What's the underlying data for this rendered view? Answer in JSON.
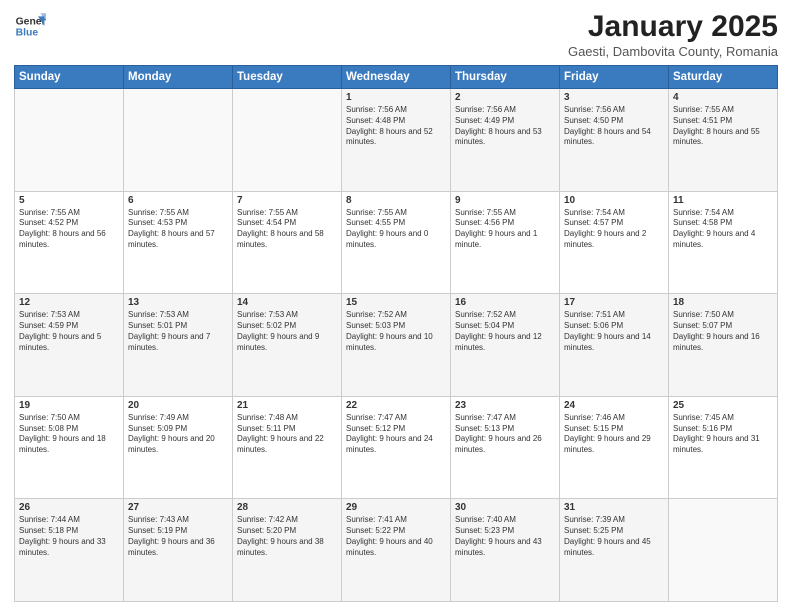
{
  "logo": {
    "line1": "General",
    "line2": "Blue"
  },
  "title": "January 2025",
  "subtitle": "Gaesti, Dambovita County, Romania",
  "weekdays": [
    "Sunday",
    "Monday",
    "Tuesday",
    "Wednesday",
    "Thursday",
    "Friday",
    "Saturday"
  ],
  "weeks": [
    [
      {
        "day": "",
        "info": ""
      },
      {
        "day": "",
        "info": ""
      },
      {
        "day": "",
        "info": ""
      },
      {
        "day": "1",
        "info": "Sunrise: 7:56 AM\nSunset: 4:48 PM\nDaylight: 8 hours and 52 minutes."
      },
      {
        "day": "2",
        "info": "Sunrise: 7:56 AM\nSunset: 4:49 PM\nDaylight: 8 hours and 53 minutes."
      },
      {
        "day": "3",
        "info": "Sunrise: 7:56 AM\nSunset: 4:50 PM\nDaylight: 8 hours and 54 minutes."
      },
      {
        "day": "4",
        "info": "Sunrise: 7:55 AM\nSunset: 4:51 PM\nDaylight: 8 hours and 55 minutes."
      }
    ],
    [
      {
        "day": "5",
        "info": "Sunrise: 7:55 AM\nSunset: 4:52 PM\nDaylight: 8 hours and 56 minutes."
      },
      {
        "day": "6",
        "info": "Sunrise: 7:55 AM\nSunset: 4:53 PM\nDaylight: 8 hours and 57 minutes."
      },
      {
        "day": "7",
        "info": "Sunrise: 7:55 AM\nSunset: 4:54 PM\nDaylight: 8 hours and 58 minutes."
      },
      {
        "day": "8",
        "info": "Sunrise: 7:55 AM\nSunset: 4:55 PM\nDaylight: 9 hours and 0 minutes."
      },
      {
        "day": "9",
        "info": "Sunrise: 7:55 AM\nSunset: 4:56 PM\nDaylight: 9 hours and 1 minute."
      },
      {
        "day": "10",
        "info": "Sunrise: 7:54 AM\nSunset: 4:57 PM\nDaylight: 9 hours and 2 minutes."
      },
      {
        "day": "11",
        "info": "Sunrise: 7:54 AM\nSunset: 4:58 PM\nDaylight: 9 hours and 4 minutes."
      }
    ],
    [
      {
        "day": "12",
        "info": "Sunrise: 7:53 AM\nSunset: 4:59 PM\nDaylight: 9 hours and 5 minutes."
      },
      {
        "day": "13",
        "info": "Sunrise: 7:53 AM\nSunset: 5:01 PM\nDaylight: 9 hours and 7 minutes."
      },
      {
        "day": "14",
        "info": "Sunrise: 7:53 AM\nSunset: 5:02 PM\nDaylight: 9 hours and 9 minutes."
      },
      {
        "day": "15",
        "info": "Sunrise: 7:52 AM\nSunset: 5:03 PM\nDaylight: 9 hours and 10 minutes."
      },
      {
        "day": "16",
        "info": "Sunrise: 7:52 AM\nSunset: 5:04 PM\nDaylight: 9 hours and 12 minutes."
      },
      {
        "day": "17",
        "info": "Sunrise: 7:51 AM\nSunset: 5:06 PM\nDaylight: 9 hours and 14 minutes."
      },
      {
        "day": "18",
        "info": "Sunrise: 7:50 AM\nSunset: 5:07 PM\nDaylight: 9 hours and 16 minutes."
      }
    ],
    [
      {
        "day": "19",
        "info": "Sunrise: 7:50 AM\nSunset: 5:08 PM\nDaylight: 9 hours and 18 minutes."
      },
      {
        "day": "20",
        "info": "Sunrise: 7:49 AM\nSunset: 5:09 PM\nDaylight: 9 hours and 20 minutes."
      },
      {
        "day": "21",
        "info": "Sunrise: 7:48 AM\nSunset: 5:11 PM\nDaylight: 9 hours and 22 minutes."
      },
      {
        "day": "22",
        "info": "Sunrise: 7:47 AM\nSunset: 5:12 PM\nDaylight: 9 hours and 24 minutes."
      },
      {
        "day": "23",
        "info": "Sunrise: 7:47 AM\nSunset: 5:13 PM\nDaylight: 9 hours and 26 minutes."
      },
      {
        "day": "24",
        "info": "Sunrise: 7:46 AM\nSunset: 5:15 PM\nDaylight: 9 hours and 29 minutes."
      },
      {
        "day": "25",
        "info": "Sunrise: 7:45 AM\nSunset: 5:16 PM\nDaylight: 9 hours and 31 minutes."
      }
    ],
    [
      {
        "day": "26",
        "info": "Sunrise: 7:44 AM\nSunset: 5:18 PM\nDaylight: 9 hours and 33 minutes."
      },
      {
        "day": "27",
        "info": "Sunrise: 7:43 AM\nSunset: 5:19 PM\nDaylight: 9 hours and 36 minutes."
      },
      {
        "day": "28",
        "info": "Sunrise: 7:42 AM\nSunset: 5:20 PM\nDaylight: 9 hours and 38 minutes."
      },
      {
        "day": "29",
        "info": "Sunrise: 7:41 AM\nSunset: 5:22 PM\nDaylight: 9 hours and 40 minutes."
      },
      {
        "day": "30",
        "info": "Sunrise: 7:40 AM\nSunset: 5:23 PM\nDaylight: 9 hours and 43 minutes."
      },
      {
        "day": "31",
        "info": "Sunrise: 7:39 AM\nSunset: 5:25 PM\nDaylight: 9 hours and 45 minutes."
      },
      {
        "day": "",
        "info": ""
      }
    ]
  ]
}
